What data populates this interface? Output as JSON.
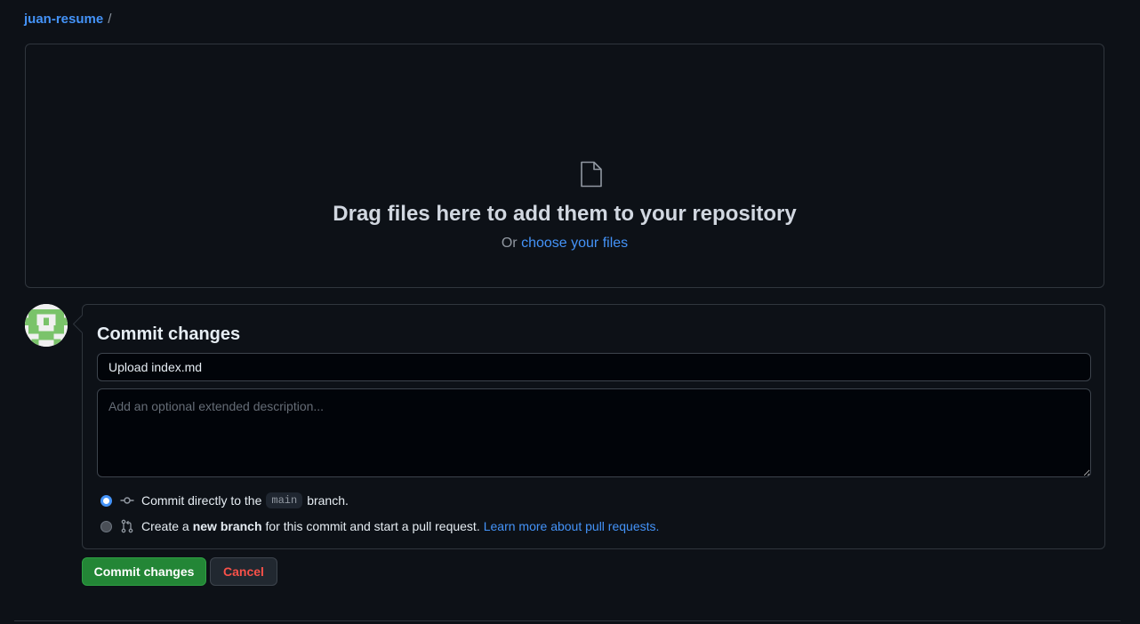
{
  "breadcrumb": {
    "repo": "juan-resume",
    "separator": "/"
  },
  "dropzone": {
    "icon": "file-icon",
    "headline": "Drag files here to add them to your repository",
    "or_text": "Or",
    "choose_link": "choose your files"
  },
  "commit": {
    "title": "Commit changes",
    "summary_value": "Upload index.md",
    "description_placeholder": "Add an optional extended description...",
    "option_direct": {
      "prefix": "Commit directly to the",
      "branch": "main",
      "suffix": "branch.",
      "selected": true
    },
    "option_new_branch": {
      "prefix": "Create a",
      "bold": "new branch",
      "suffix": "for this commit and start a pull request.",
      "link": "Learn more about pull requests.",
      "selected": false
    }
  },
  "buttons": {
    "commit": "Commit changes",
    "cancel": "Cancel"
  },
  "colors": {
    "background": "#0d1117",
    "link": "#4493f8",
    "primary_button": "#238636",
    "danger_text": "#f85149"
  }
}
